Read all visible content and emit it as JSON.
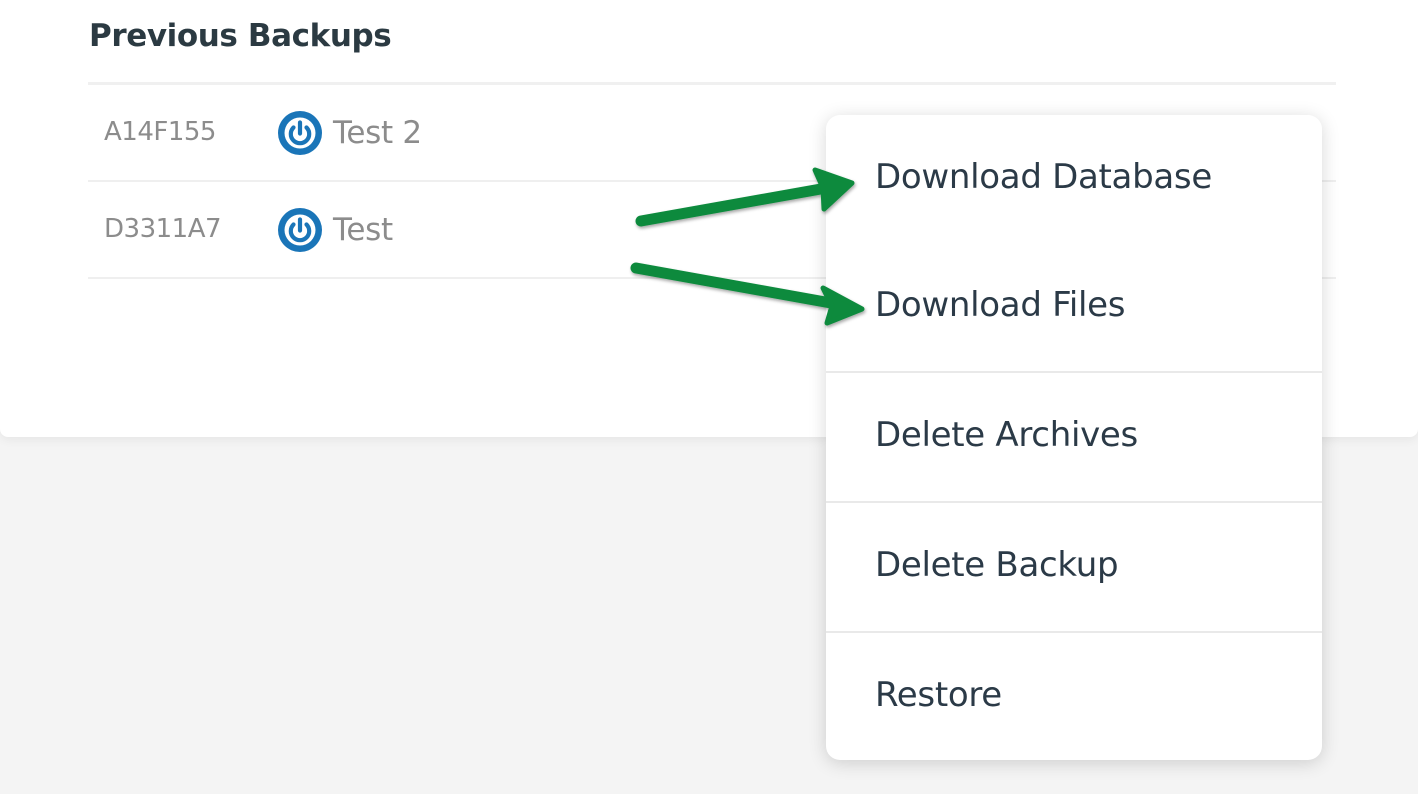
{
  "section": {
    "title": "Previous Backups"
  },
  "backups": [
    {
      "id": "A14F155",
      "site_name": "Test 2",
      "site_icon": "power-icon"
    },
    {
      "id": "D3311A7",
      "site_name": "Test",
      "site_icon": "power-icon"
    }
  ],
  "context_menu": {
    "items": [
      {
        "label": "Download Database"
      },
      {
        "label": "Download Files"
      },
      {
        "label": "Delete Archives"
      },
      {
        "label": "Delete Backup"
      },
      {
        "label": "Restore"
      }
    ]
  },
  "annotations": {
    "arrow_color": "#0a8a3c",
    "arrow_icon": "arrow-right-icon"
  },
  "colors": {
    "icon_blue": "#1a75b8",
    "menu_text": "#2b3a47",
    "muted_text": "#8c8c8c",
    "page_background": "#f4f4f4"
  }
}
